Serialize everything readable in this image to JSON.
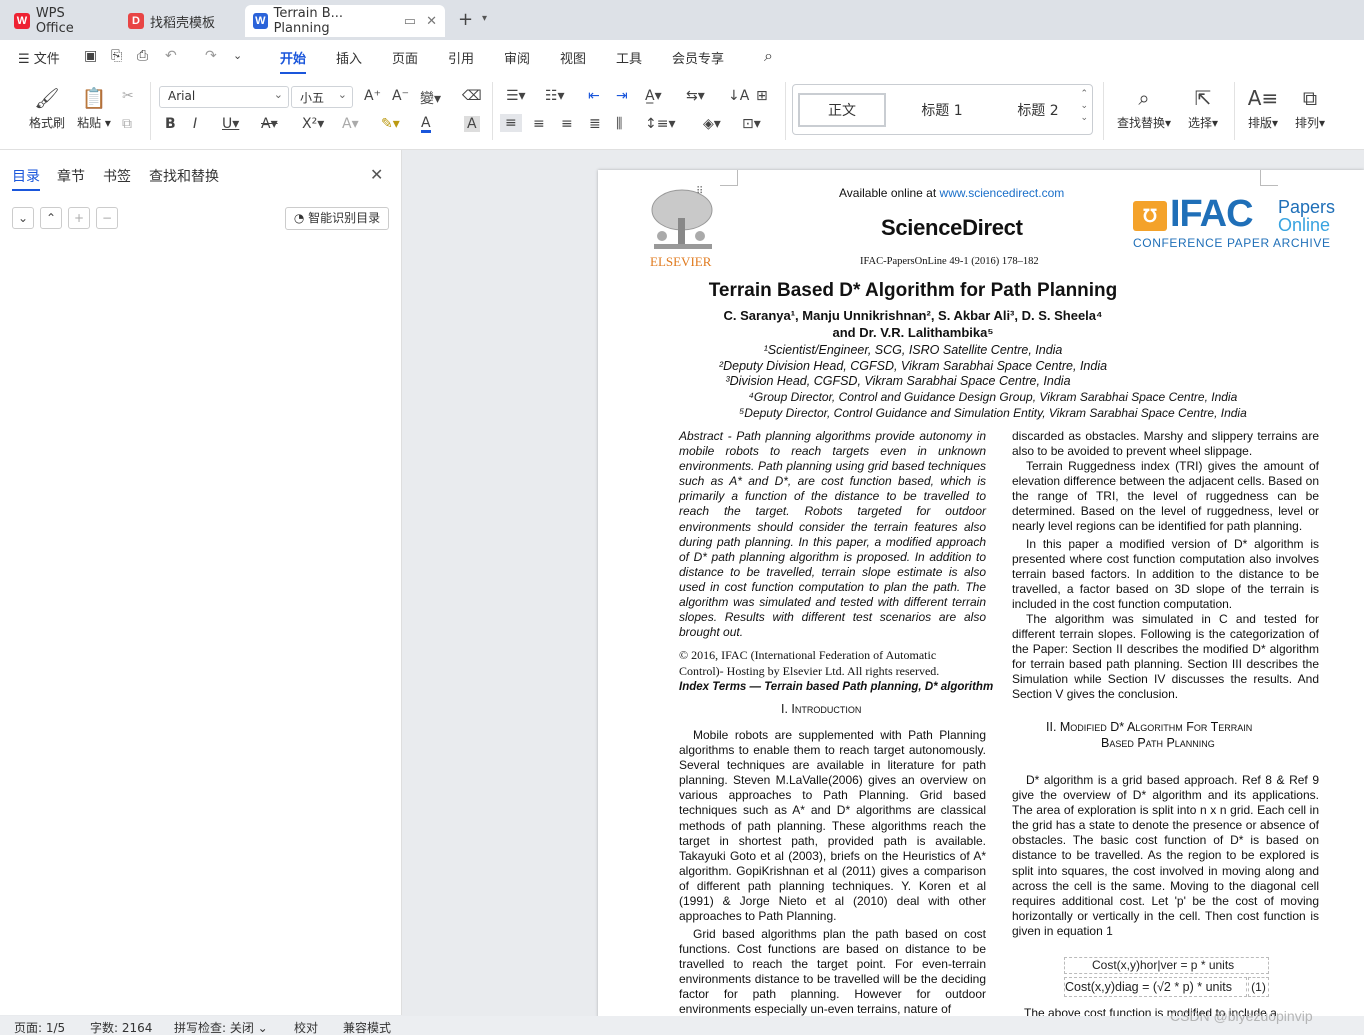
{
  "tabs": [
    {
      "label": "WPS Office",
      "icon": "wps-logo-icon"
    },
    {
      "label": "找稻壳模板",
      "icon": "docer-icon"
    },
    {
      "label": "Terrain B... Planning",
      "icon": "word-doc-icon"
    }
  ],
  "menu": [
    "文件",
    "开始",
    "插入",
    "页面",
    "引用",
    "审阅",
    "视图",
    "工具",
    "会员专享"
  ],
  "ribbon": {
    "format_brush": "格式刷",
    "paste": "粘贴",
    "font_name": "Arial",
    "font_size": "小五",
    "styles": [
      "正文",
      "标题 1",
      "标题 2"
    ],
    "find_replace": "查找替换",
    "select": "选择",
    "layout": "排版",
    "arrange": "排列"
  },
  "nav": {
    "tabs": [
      "目录",
      "章节",
      "书签",
      "查找和替换"
    ],
    "smart_toc": "智能识别目录"
  },
  "doc": {
    "available_online": "Available online at ",
    "site": "www.sciencedirect.com",
    "journal": "ScienceDirect",
    "citation": "IFAC-PapersOnLine 49-1 (2016) 178–182",
    "publisher": "ELSEVIER",
    "ifac_big": "IFAC",
    "ifac_papers": "Papers",
    "ifac_online": "Online",
    "ifac_sub": "CONFERENCE PAPER ARCHIVE",
    "title": "Terrain Based D* Algorithm for Path Planning",
    "authors1": "C. Saranya¹, Manju Unnikrishnan², S. Akbar Ali³, D. S. Sheela⁴",
    "authors2": "and Dr. V.R. Lalithambika⁵",
    "aff": [
      "¹Scientist/Engineer, SCG, ISRO Satellite Centre, India",
      "²Deputy Division Head, CGFSD, Vikram Sarabhai Space Centre, India",
      "³Division Head, CGFSD, Vikram Sarabhai Space Centre, India",
      "⁴Group Director, Control and Guidance Design Group, Vikram Sarabhai Space Centre, India",
      "⁵Deputy Director, Control Guidance and Simulation Entity, Vikram Sarabhai Space Centre, India"
    ],
    "abstract": "Abstract - Path planning algorithms provide autonomy in mobile robots to reach targets even in unknown environments. Path planning using grid based techniques such as A* and D*, are cost function based, which is primarily a function of the distance to be travelled to reach the target. Robots targeted for outdoor environments should consider the terrain features also during path planning. In this paper, a modified approach of D* path planning algorithm is proposed. In addition to distance to be travelled, terrain slope estimate is also used in cost function computation to plan the path. The algorithm was simulated and tested with different terrain slopes. Results with different test scenarios are also brought out.",
    "copyright1": "© 2016, IFAC (International Federation of Automatic",
    "copyright2": "Control)- Hosting by Elsevier Ltd. All rights reserved.",
    "index_terms": "Index Terms — Terrain based Path planning, D* algorithm",
    "sec1": "I.     Introduction",
    "intro_p1": "Mobile robots are supplemented with Path Planning algorithms to enable them to reach target autonomously. Several techniques are available in literature for path planning. Steven M.LaValle(2006) gives an overview on various approaches to Path Planning. Grid based techniques such as A* and D* algorithms are classical methods of path planning. These algorithms reach the target in shortest path, provided path is available. Takayuki Goto et al (2003), briefs on the Heuristics of A* algorithm. GopiKrishnan et al (2011) gives a comparison of different path planning techniques. Y. Koren et al (1991) & Jorge Nieto et al (2010) deal with other approaches to Path Planning.",
    "intro_p2": "Grid based algorithms plan the path based on cost functions. Cost functions are based on distance to be travelled to reach the target point. For even-terrain environments distance to be travelled will be the deciding factor for path planning. However for outdoor environments especially un-even terrains, nature of",
    "r_p0": "discarded as obstacles. Marshy and slippery terrains are also to be avoided to prevent wheel slippage.",
    "r_p1": "Terrain Ruggedness index (TRI) gives the amount of elevation difference between the adjacent cells. Based on the range of TRI, the level of ruggedness can be determined. Based on the level of ruggedness, level or nearly level regions can be identified for path planning.",
    "r_p2": "In this paper a modified version of D* algorithm is presented where cost function computation also involves terrain based factors. In addition to the distance to be travelled, a factor based on 3D slope of the terrain is included in the cost function computation.",
    "r_p3": "The algorithm was simulated in C and tested for different terrain slopes. Following is the categorization of the Paper: Section II describes the modified D* algorithm for terrain based path planning. Section III describes the Simulation while Section IV discusses the results. And Section V gives the conclusion.",
    "sec2a": "II.     Modified D* Algorithm For Terrain",
    "sec2b": "Based Path Planning",
    "r_p4": "D* algorithm is a grid based approach. Ref 8 & Ref 9 give the overview of D* algorithm and its applications. The area of exploration is split into n x n grid. Each cell in the grid has a state to denote the presence or absence of obstacles. The basic cost function of D* is based on distance to be travelled. As the region to be explored is split into squares, the cost involved in moving along and across the cell is the same. Moving to the diagonal cell requires additional cost. Let 'p' be the cost of moving horizontally or vertically in the cell. Then cost function is given in equation 1",
    "eq1": "Cost(x,y)hor|ver = p * units",
    "eq2": "Cost(x,y)diag = (√2 * p) * units",
    "eq_num": "(1)",
    "r_tail": "The above cost function is modified to include a"
  },
  "status": {
    "page": "页面: 1/5",
    "words": "字数: 2164",
    "spell": "拼写检查: 关闭",
    "proof": "校对",
    "compat": "兼容模式"
  },
  "watermark": "CSDN @biyezuopinvip"
}
